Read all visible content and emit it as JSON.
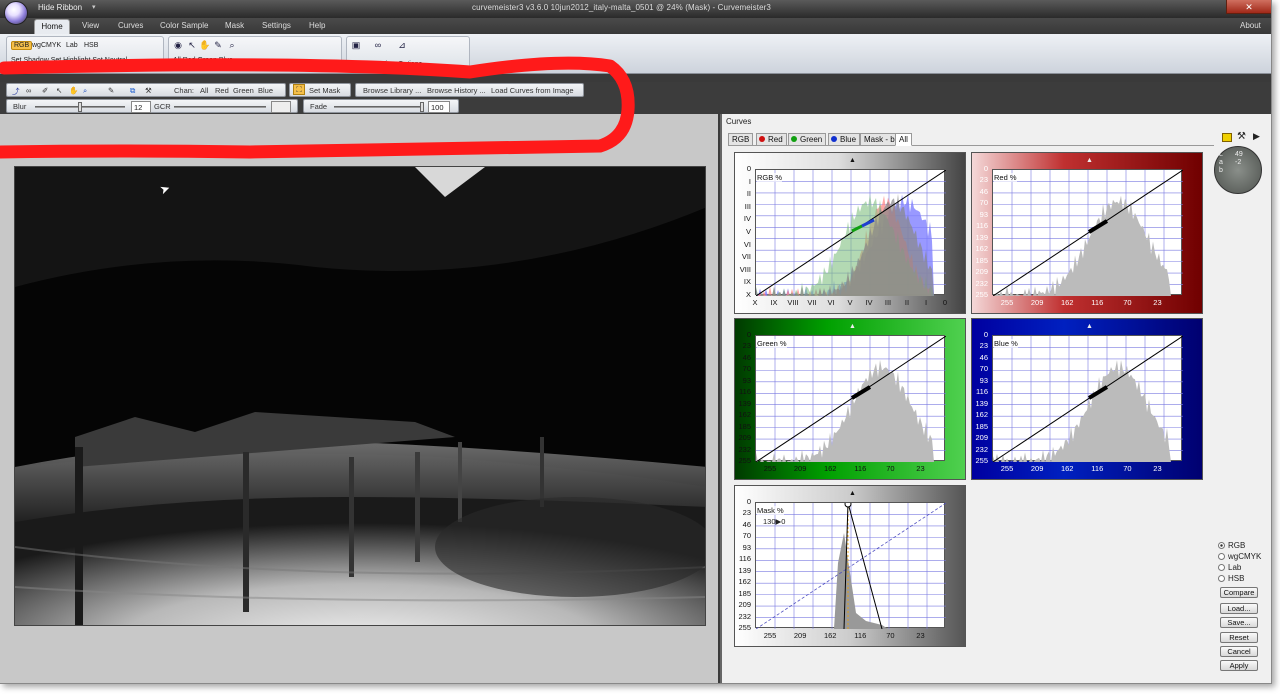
{
  "window": {
    "hide_ribbon": "Hide Ribbon",
    "title": "curvemeister3 v3.6.0     10jun2012_italy-malta_0501 @ 24% (Mask) - Curvemeister3",
    "close": "✕"
  },
  "menu": {
    "home": "Home",
    "view": "View",
    "curves": "Curves",
    "color_sample": "Color Sample",
    "mask": "Mask",
    "settings": "Settings",
    "help": "Help",
    "about": "About"
  },
  "ribbon": {
    "modes": [
      "RGB",
      "wgCMYK",
      "Lab",
      "HSB"
    ],
    "set_row": "Set Shadow  Set Highlight  Set Neutral",
    "chan_row": "All   Red   Green   Blue",
    "view_options": "View Options"
  },
  "toolbar1": {
    "chan_label": "Chan:",
    "channels": [
      "All",
      "Red",
      "Green",
      "Blue"
    ],
    "set_mask": "Set Mask",
    "browse_library": "Browse Library ...",
    "browse_history": "Browse History ...",
    "load_curves": "Load Curves from Image"
  },
  "toolbar2": {
    "blur_label": "Blur",
    "blur_value": "12",
    "gcr_label": "GCR",
    "gcr_value": "",
    "fade_label": "Fade",
    "fade_value": "100",
    "blur_level": 0.5,
    "fade_level": 1.0
  },
  "curves_panel": {
    "title": "Curves",
    "tabs": [
      "RGB",
      "Red",
      "Green",
      "Blue",
      "Mask - b",
      "All"
    ],
    "active_tab": "All",
    "graphs": {
      "rgb": {
        "title": "RGB %",
        "y_ticks": [
          "0",
          "I",
          "II",
          "III",
          "IV",
          "V",
          "VI",
          "VII",
          "VIII",
          "IX",
          "X"
        ],
        "x_ticks": [
          "X",
          "IX",
          "VIII",
          "VII",
          "VI",
          "V",
          "IV",
          "III",
          "II",
          "I",
          "0"
        ]
      },
      "red": {
        "title": "Red %",
        "y_ticks": [
          "0",
          "23",
          "46",
          "70",
          "93",
          "116",
          "139",
          "162",
          "185",
          "209",
          "232",
          "255"
        ],
        "x_ticks": [
          "255",
          "209",
          "162",
          "116",
          "70",
          "23"
        ]
      },
      "green": {
        "title": "Green %",
        "y_ticks": [
          "0",
          "23",
          "46",
          "70",
          "93",
          "116",
          "139",
          "162",
          "185",
          "209",
          "232",
          "255"
        ],
        "x_ticks": [
          "255",
          "209",
          "162",
          "116",
          "70",
          "23"
        ]
      },
      "blue": {
        "title": "Blue %",
        "y_ticks": [
          "0",
          "23",
          "46",
          "70",
          "93",
          "116",
          "139",
          "162",
          "185",
          "209",
          "232",
          "255"
        ],
        "x_ticks": [
          "255",
          "209",
          "162",
          "116",
          "70",
          "23"
        ]
      },
      "mask": {
        "title": "Mask %",
        "readout": "130▶0",
        "y_ticks": [
          "0",
          "23",
          "46",
          "70",
          "93",
          "116",
          "139",
          "162",
          "185",
          "209",
          "232",
          "255"
        ],
        "x_ticks": [
          "255",
          "209",
          "162",
          "116",
          "70",
          "23"
        ]
      }
    },
    "readout": {
      "l": "49",
      "a": "-2",
      "b": ""
    },
    "readout_labels": {
      "l": "L",
      "a": "a",
      "b": "b"
    },
    "color_spaces": [
      "RGB",
      "wgCMYK",
      "Lab",
      "HSB"
    ],
    "selected_space": "RGB",
    "buttons": {
      "compare": "Compare",
      "load": "Load...",
      "save": "Save...",
      "reset": "Reset",
      "cancel": "Cancel",
      "apply": "Apply"
    }
  },
  "colors": {
    "annotation_red": "#ff1a1a",
    "red_panel": "#8a0000",
    "green_panel": "#00a000",
    "blue_panel": "#00008a",
    "grid": "#7a7ae0"
  }
}
